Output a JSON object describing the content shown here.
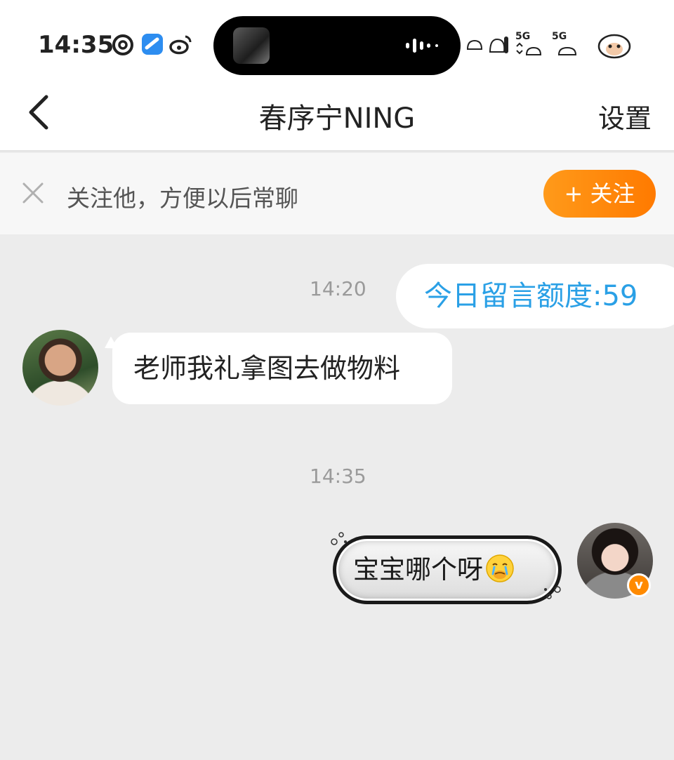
{
  "status_bar": {
    "time": "14:35",
    "icons_left": [
      "netease-music-icon",
      "app-blue-icon",
      "weibo-icon"
    ],
    "icons_right": [
      "cat-sticker-icon",
      "signal-5g-icon",
      "signal-5g-icon",
      "avatar-sticker-icon"
    ],
    "network_1": "5G",
    "network_2": "5G"
  },
  "header": {
    "title": "春序宁NING",
    "settings_label": "设置"
  },
  "follow_bar": {
    "prompt": "关注他，方便以后常聊",
    "follow_label": "+ 关注"
  },
  "messages": [
    {
      "time": "14:20",
      "side": "right",
      "text": "今日留言额度:59",
      "type": "quota"
    },
    {
      "side": "left",
      "text": "老师我礼拿图去做物料"
    },
    {
      "time": "14:35",
      "side": "right",
      "text": "宝宝哪个呀",
      "emoji": "tearful-face-emoji"
    }
  ],
  "colors": {
    "accent_orange": "#ff8a00",
    "quota_blue": "#2aa0e6",
    "chat_bg": "#ececec"
  },
  "vip_badge": "v"
}
